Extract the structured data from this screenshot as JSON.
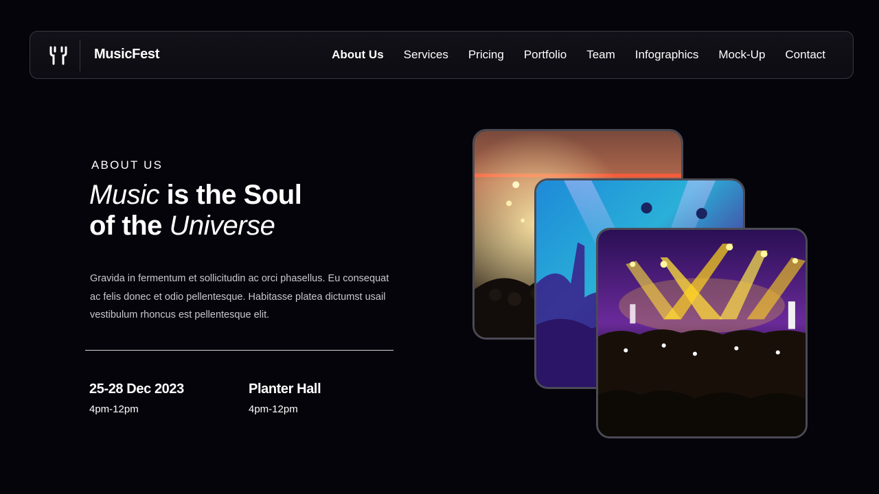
{
  "nav": {
    "brand": "MusicFest",
    "links": [
      {
        "label": "About Us",
        "active": true
      },
      {
        "label": "Services"
      },
      {
        "label": "Pricing"
      },
      {
        "label": "Portfolio"
      },
      {
        "label": "Team"
      },
      {
        "label": "Infographics"
      },
      {
        "label": "Mock-Up"
      },
      {
        "label": "Contact"
      }
    ]
  },
  "hero": {
    "eyebrow": "ABOUT US",
    "headline": {
      "l1_italic": "Music",
      "l1_rest": " is the Soul",
      "l2_start": "of the ",
      "l2_italic": "Universe"
    },
    "body": "Gravida in fermentum et sollicitudin ac orci phasellus. Eu consequat ac felis donec et odio pellentesque. Habitasse platea dictumst usail vestibulum rhoncus est pellentesque elit.",
    "info": [
      {
        "title": "25-28 Dec 2023",
        "sub": "4pm-12pm"
      },
      {
        "title": "Planter Hall",
        "sub": "4pm-12pm"
      }
    ]
  },
  "images": [
    {
      "name": "concert-photo-stage-lights"
    },
    {
      "name": "concert-photo-blue-crowd"
    },
    {
      "name": "concert-photo-yellow-lasers"
    }
  ],
  "colors": {
    "background": "#05040b",
    "nav_border": "#3a3942",
    "text": "#ffffff",
    "body_text": "#c9c8d0",
    "card_border": "#4b4a55"
  }
}
